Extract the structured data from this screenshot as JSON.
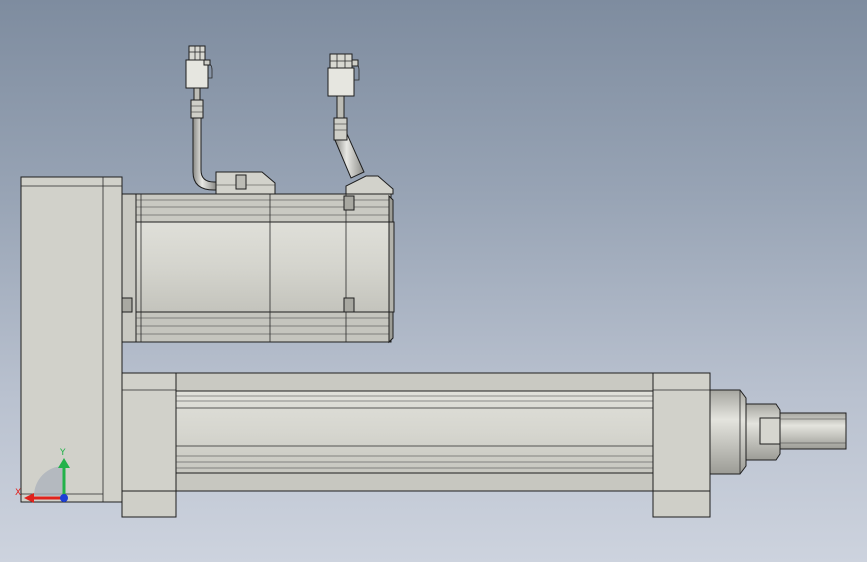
{
  "viewport": {
    "background_top": "#7e8c9f",
    "background_bottom": "#cdd3de",
    "part_color": "#d3d3cc",
    "edge_color": "#1e1e1e"
  },
  "model": {
    "components": [
      "end-block-housing",
      "servo-motor",
      "motor-cable-left",
      "motor-cable-right",
      "connector-left",
      "connector-right",
      "actuator-tube",
      "rear-flange",
      "front-flange",
      "rod-bearing",
      "piston-rod"
    ]
  },
  "triad": {
    "x_label": "X",
    "y_label": "Y",
    "x_color": "#e0221c",
    "y_color": "#22b24a",
    "z_color": "#1d3fd6"
  }
}
